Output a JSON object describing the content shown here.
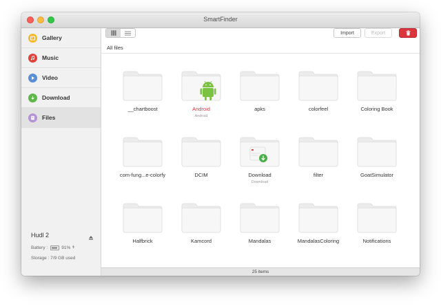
{
  "window": {
    "title": "SmartFinder"
  },
  "sidebar": {
    "items": [
      {
        "label": "Gallery",
        "icon": "gallery-icon",
        "color": "#f5b829"
      },
      {
        "label": "Music",
        "icon": "music-icon",
        "color": "#e0413b"
      },
      {
        "label": "Video",
        "icon": "video-icon",
        "color": "#5a8fd6"
      },
      {
        "label": "Download",
        "icon": "download-icon",
        "color": "#5fb64b"
      },
      {
        "label": "Files",
        "icon": "files-icon",
        "color": "#b492d6"
      }
    ],
    "active": "Files",
    "device": {
      "name": "Hudl 2",
      "battery_label": "Battery :",
      "battery_value": "91%",
      "battery_level": 0.91,
      "storage": "Storage : 7/9 GB used"
    }
  },
  "toolbar": {
    "import_label": "Import",
    "export_label": "Export",
    "view_mode": "grid"
  },
  "breadcrumb": "All files",
  "files": [
    {
      "name": "__chartboost",
      "sub": "",
      "badge": ""
    },
    {
      "name": "Android",
      "sub": "Android",
      "badge": "android"
    },
    {
      "name": "apks",
      "sub": "",
      "badge": ""
    },
    {
      "name": "colorfeel",
      "sub": "",
      "badge": ""
    },
    {
      "name": "Coloring Book",
      "sub": "",
      "badge": ""
    },
    {
      "name": "com-fung...e-colorfy",
      "sub": "",
      "badge": ""
    },
    {
      "name": "DCIM",
      "sub": "",
      "badge": ""
    },
    {
      "name": "Download",
      "sub": "Download",
      "badge": "download"
    },
    {
      "name": "filter",
      "sub": "",
      "badge": ""
    },
    {
      "name": "GoatSimulator",
      "sub": "",
      "badge": ""
    },
    {
      "name": "Halfbrick",
      "sub": "",
      "badge": ""
    },
    {
      "name": "Kamcord",
      "sub": "",
      "badge": ""
    },
    {
      "name": "Mandalas",
      "sub": "",
      "badge": ""
    },
    {
      "name": "MandalasColoring",
      "sub": "",
      "badge": ""
    },
    {
      "name": "Notifications",
      "sub": "",
      "badge": ""
    }
  ],
  "status": {
    "count": "25 items"
  },
  "colors": {
    "delete": "#d9363e",
    "android_green": "#7cc242",
    "highlight": "#d9363e"
  }
}
